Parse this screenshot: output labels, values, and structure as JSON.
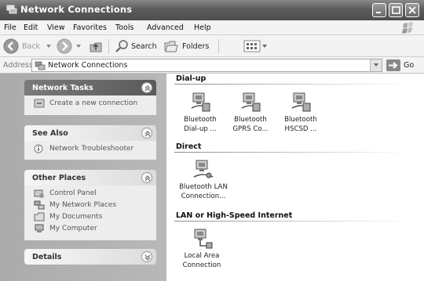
{
  "window": {
    "title": "Network Connections"
  },
  "menu": [
    "File",
    "Edit",
    "View",
    "Favorites",
    "Tools",
    "Advanced",
    "Help"
  ],
  "toolbar": {
    "back": "Back",
    "search": "Search",
    "folders": "Folders"
  },
  "address": {
    "label": "Address",
    "value": "Network Connections",
    "go": "Go"
  },
  "panels": {
    "network_tasks": {
      "title": "Network Tasks",
      "items": [
        "Create a new connection"
      ]
    },
    "see_also": {
      "title": "See Also",
      "items": [
        "Network Troubleshooter"
      ]
    },
    "other_places": {
      "title": "Other Places",
      "items": [
        "Control Panel",
        "My Network Places",
        "My Documents",
        "My Computer"
      ]
    },
    "details": {
      "title": "Details"
    }
  },
  "groups": [
    {
      "title": "Dial-up",
      "items": [
        {
          "line1": "Bluetooth",
          "line2": "Dial-up ..."
        },
        {
          "line1": "Bluetooth",
          "line2": "GPRS Co..."
        },
        {
          "line1": "Bluetooth",
          "line2": "HSCSD ..."
        }
      ]
    },
    {
      "title": "Direct",
      "items": [
        {
          "line1": "Bluetooth LAN",
          "line2": "Connection..."
        }
      ]
    },
    {
      "title": "LAN or High-Speed Internet",
      "items": [
        {
          "line1": "Local Area",
          "line2": "Connection"
        }
      ]
    }
  ]
}
